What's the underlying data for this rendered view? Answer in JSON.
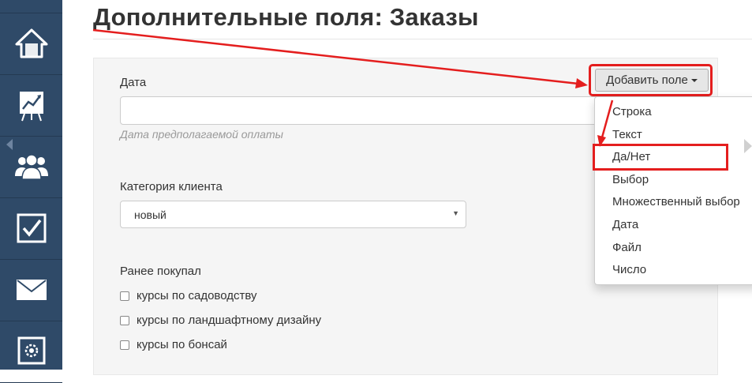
{
  "page": {
    "title": "Дополнительные поля: Заказы"
  },
  "sidebar": {
    "items": [
      {
        "icon": "home-icon"
      },
      {
        "icon": "chart-icon"
      },
      {
        "icon": "users-icon"
      },
      {
        "icon": "checkbox-icon"
      },
      {
        "icon": "mail-icon"
      },
      {
        "icon": "settings-icon"
      }
    ],
    "colors": {
      "background": "#2f4a68",
      "icon": "#ffffff"
    }
  },
  "form": {
    "date_label": "Дата",
    "date_value": "",
    "date_hint": "Дата предполагаемой оплаты",
    "category_label": "Категория клиента",
    "category_value": "новый",
    "previous_label": "Ранее покупал",
    "previous_options": [
      {
        "label": "курсы по садоводству",
        "checked": false
      },
      {
        "label": "курсы по ландшафтному дизайну",
        "checked": false
      },
      {
        "label": "курсы по бонсай",
        "checked": false
      }
    ]
  },
  "add_field": {
    "button_label": "Добавить поле",
    "menu_items": [
      "Строка",
      "Текст",
      "Да/Нет",
      "Выбор",
      "Множественный выбор",
      "Дата",
      "Файл",
      "Число"
    ],
    "highlighted_item": "Да/Нет"
  },
  "annotation": {
    "color": "#e41e1e"
  }
}
